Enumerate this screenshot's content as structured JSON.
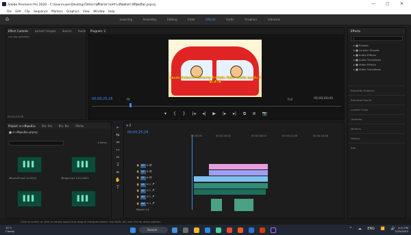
{
  "window": {
    "title": "Adobe Premiere Pro 2020 - C:\\Users\\user\\Desktop\\โครงงานศึกษาดาวเคราะห์น้อย\\ดาวที่ชุดเมือง.prproj",
    "minimize": "—",
    "maximize": "▢",
    "close": "✕"
  },
  "menu": [
    "File",
    "Edit",
    "Clip",
    "Sequence",
    "Markers",
    "Graphics",
    "View",
    "Window",
    "Help"
  ],
  "workspaces": {
    "items": [
      "Learning",
      "Assembly",
      "Editing",
      "Color",
      "Effects",
      "Audio",
      "Graphics",
      "Libraries"
    ],
    "active": "Effects"
  },
  "effect_controls": {
    "tabs": [
      "Effect Controls",
      "Lumetri Scopes",
      "Source",
      "Audio"
    ],
    "active_tab": "Effect Controls",
    "message": "(no clip selected)",
    "timecode": "00;00;25;26"
  },
  "program": {
    "tab": "Program: 2",
    "timecode": "00;00;25;26",
    "fit": "Fit",
    "full": "Full",
    "duration": "00;00;00;00",
    "subtitle": "ของเล่น ตัวต่อเลโก เรือกระดาษ ต้าตรันบิน เรือบิน รถบังคับ ของเล่น มีล้อ ทำได้",
    "transport": [
      "▾",
      "{",
      "}",
      "|◂",
      "◂|",
      "▶",
      "|▸",
      "▸|",
      "⧉",
      "⧈",
      "📷"
    ]
  },
  "effects_panel": {
    "title": "Effects",
    "search_placeholder": "",
    "folders": [
      "Presets",
      "Lumetri Presets",
      "Audio Effects",
      "Audio Transitions",
      "Video Effects",
      "Video Transitions"
    ],
    "sections": [
      "Essential Graphics",
      "Essential Sound",
      "Lumetri Color",
      "Libraries",
      "Markers",
      "History",
      "Info"
    ]
  },
  "project": {
    "tabs": [
      "Project: ดาวที่ชุดเมือง",
      "Bin: Bin",
      "Bin: Bin",
      "Media"
    ],
    "name": "ดาวที่ชุดเมือง.prproj",
    "items_count": "4 Items",
    "clips": [
      {
        "name": "เสียงดนตรี.mp3",
        "duration": "10;55;02"
      },
      {
        "name": "เสียงพูด.mp3",
        "duration": "1;40;12832"
      },
      {
        "name": "",
        "duration": ""
      },
      {
        "name": "",
        "duration": ""
      }
    ]
  },
  "tools": [
    "▸",
    "⇆",
    "⇔",
    "⇿",
    "✂",
    "↧",
    "✒",
    "✋",
    "T"
  ],
  "timeline": {
    "tab": "2",
    "timecode": "00;00;25;26",
    "ruler": [
      "00;00;00",
      "00;01;04;02",
      "00;02;08;04",
      "00;03;12;06",
      "00;04;16;08"
    ],
    "tracks": [
      {
        "label": "V3"
      },
      {
        "label": "V2"
      },
      {
        "label": "V1"
      },
      {
        "label": "A1"
      },
      {
        "label": "A2"
      },
      {
        "label": "A3"
      },
      {
        "label": "A4"
      }
    ],
    "master": "Master",
    "master_value": "0.0"
  },
  "status": "Click to select, or click in empty space and drag to marquee select. Use Shift, Alt, and Ctrl for other options.",
  "taskbar": {
    "temp": "32°C",
    "weather": "Cloudy",
    "search": "Search",
    "time": "4:21 PM",
    "date": "2/25/2023",
    "tray": [
      "^",
      "☁",
      "ENG",
      "📶",
      "🔊"
    ]
  }
}
